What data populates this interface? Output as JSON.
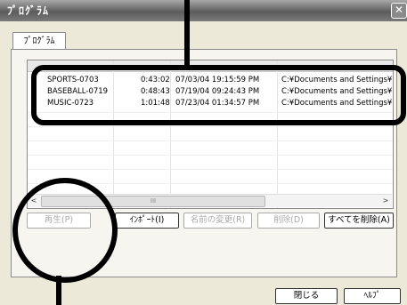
{
  "window": {
    "title": "ﾌﾟﾛｸﾞﾗﾑ",
    "close_glyph": "✕"
  },
  "tab": {
    "label": "ﾌﾟﾛｸﾞﾗﾑ"
  },
  "list": {
    "rows": [
      {
        "name": "SPORTS-0703",
        "duration": "0:43:02",
        "date": "07/03/04 19:15:59 PM",
        "path": "C:¥Documents and Settings¥N"
      },
      {
        "name": "BASEBALL-0719",
        "duration": "0:48:43",
        "date": "07/19/04 09:24:43 PM",
        "path": "C:¥Documents and Settings¥N"
      },
      {
        "name": "MUSIC-0723",
        "duration": "1:01:48",
        "date": "07/23/04 01:34:57 PM",
        "path": "C:¥Documents and Settings¥N"
      }
    ]
  },
  "scrollbar": {
    "left_arrow": "<",
    "right_arrow": ">",
    "grip": "III"
  },
  "buttons": {
    "play": "再生(P)",
    "import": "ｲﾝﾎﾟｰﾄ(I)",
    "rename": "名前の変更(R)",
    "delete": "削除(D)",
    "delete_all": "すべてを削除(A)",
    "close": "閉じる",
    "help": "ﾍﾙﾌﾟ"
  }
}
